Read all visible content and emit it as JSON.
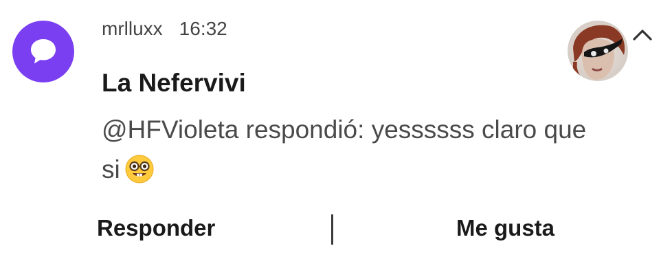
{
  "notification": {
    "app_name": "mrlluxx",
    "time": "16:32",
    "title": "La Nefervivi",
    "message_text": "@HFVioleta respondió: yessssss claro que si",
    "app_icon": "chat-bubble-icon",
    "emoji": "nerd-face-icon",
    "chevron": "chevron-up-icon"
  },
  "actions": {
    "reply_label": "Responder",
    "like_label": "Me gusta"
  },
  "colors": {
    "app_icon_bg": "#7b3ff2",
    "text_primary": "#1a1a1a",
    "text_secondary": "#4a4a4a",
    "header_text": "#444444"
  }
}
